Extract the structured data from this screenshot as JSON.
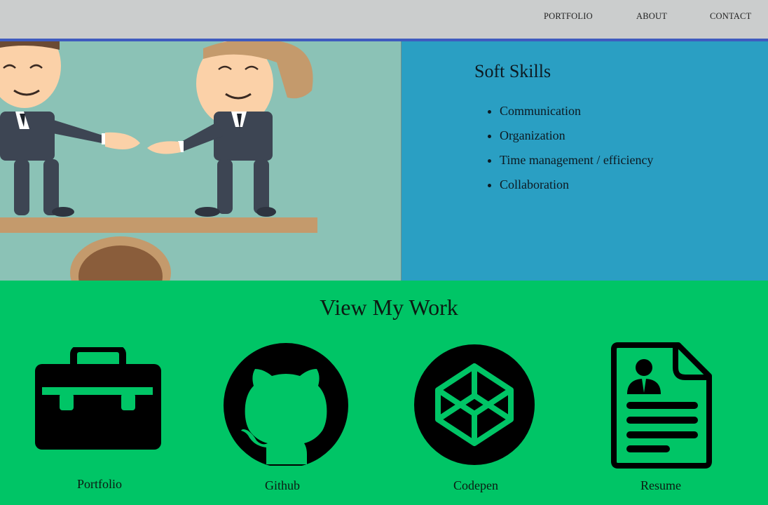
{
  "nav": {
    "items": [
      {
        "label": "PORTFOLIO"
      },
      {
        "label": "ABOUT"
      },
      {
        "label": "CONTACT"
      }
    ]
  },
  "hero": {
    "image_icon": "handshake-illustration"
  },
  "skills": {
    "title": "Soft Skills",
    "items": [
      "Communication",
      "Organization",
      "Time management / efficiency",
      "Collaboration"
    ]
  },
  "work": {
    "title": "View My Work",
    "links": [
      {
        "label": "Portfolio",
        "icon": "briefcase-icon"
      },
      {
        "label": "Github",
        "icon": "github-icon"
      },
      {
        "label": "Codepen",
        "icon": "codepen-icon"
      },
      {
        "label": "Resume",
        "icon": "resume-icon"
      }
    ]
  },
  "colors": {
    "nav_bg": "#cbcdcd",
    "nav_border": "#3f5bbf",
    "skills_bg": "#2a9fc3",
    "work_bg": "#00c566",
    "hero_bg": "#8bc2b6"
  }
}
